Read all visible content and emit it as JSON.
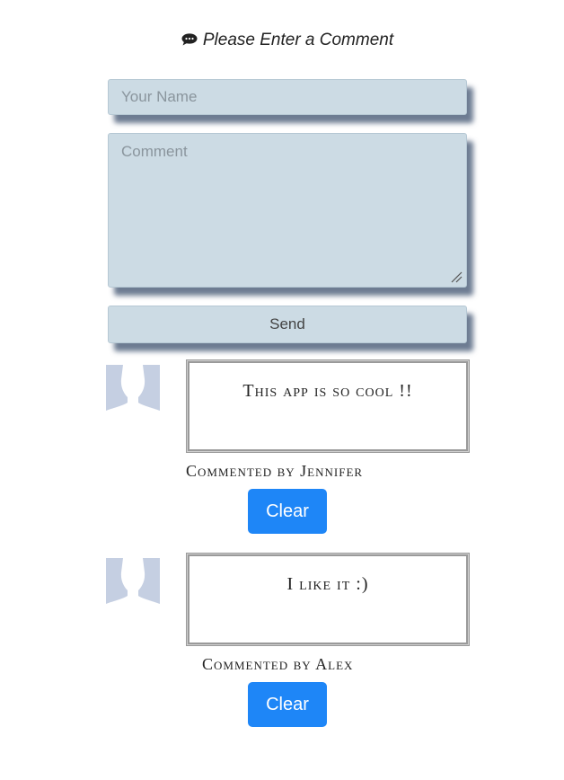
{
  "form": {
    "heading": "Please Enter a Comment",
    "heading_icon": "comment-icon",
    "name_placeholder": "Your Name",
    "comment_placeholder": "Comment",
    "send_label": "Send"
  },
  "comments": [
    {
      "text": "This app is so cool !!",
      "author_line": "Commented by Jennifer",
      "clear_label": "Clear"
    },
    {
      "text": "I like it :)",
      "author_line": "Commented by Alex",
      "clear_label": "Clear"
    }
  ],
  "colors": {
    "field_background": "#ccdbe4",
    "clear_button": "#1e86f7",
    "avatar": "#c5cfe2",
    "comment_border": "#9a9a9a"
  }
}
